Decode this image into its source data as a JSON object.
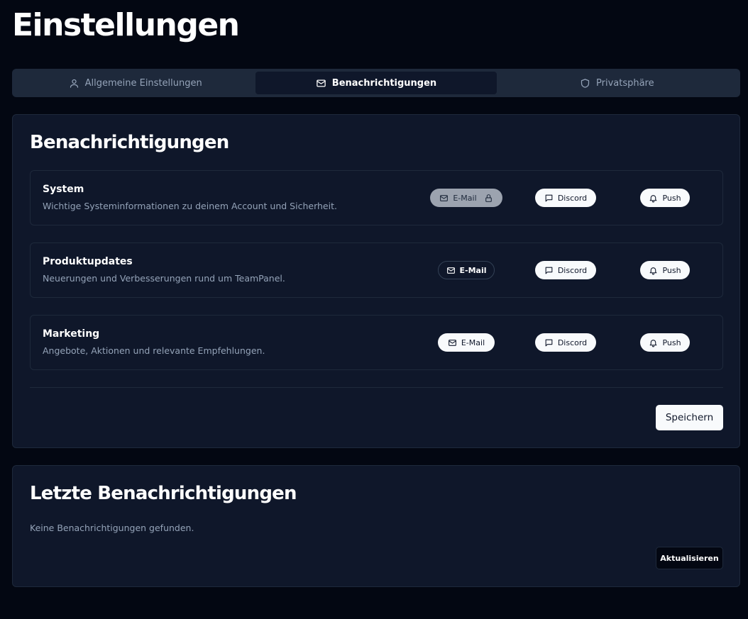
{
  "page": {
    "title": "Einstellungen"
  },
  "tabs": [
    {
      "label": "Allgemeine Einstellungen",
      "icon": "user-icon",
      "active": false
    },
    {
      "label": "Benachrichtigungen",
      "icon": "mail-icon",
      "active": true
    },
    {
      "label": "Privatsphäre",
      "icon": "shield-icon",
      "active": false
    }
  ],
  "notifications": {
    "title": "Benachrichtigungen",
    "rows": [
      {
        "title": "System",
        "description": "Wichtige Systeminformationen zu deinem Account und Sicherheit.",
        "email": {
          "label": "E-Mail",
          "state": "locked"
        },
        "discord": {
          "label": "Discord",
          "state": "on"
        },
        "push": {
          "label": "Push",
          "state": "on"
        }
      },
      {
        "title": "Produktupdates",
        "description": "Neuerungen und Verbesserungen rund um TeamPanel.",
        "email": {
          "label": "E-Mail",
          "state": "off"
        },
        "discord": {
          "label": "Discord",
          "state": "on"
        },
        "push": {
          "label": "Push",
          "state": "on"
        }
      },
      {
        "title": "Marketing",
        "description": "Angebote, Aktionen und relevante Empfehlungen.",
        "email": {
          "label": "E-Mail",
          "state": "on"
        },
        "discord": {
          "label": "Discord",
          "state": "on"
        },
        "push": {
          "label": "Push",
          "state": "on"
        }
      }
    ],
    "save_label": "Speichern"
  },
  "recent": {
    "title": "Letzte Benachrichtigungen",
    "empty_text": "Keine Benachrichtigungen gefunden.",
    "refresh_label": "Aktualisieren"
  },
  "colors": {
    "background": "#030712",
    "card": "#0f172a",
    "border": "#1e293b",
    "muted_text": "#94a3b8",
    "chip_on": "#f8fafc",
    "chip_locked": "#9ca3af"
  }
}
